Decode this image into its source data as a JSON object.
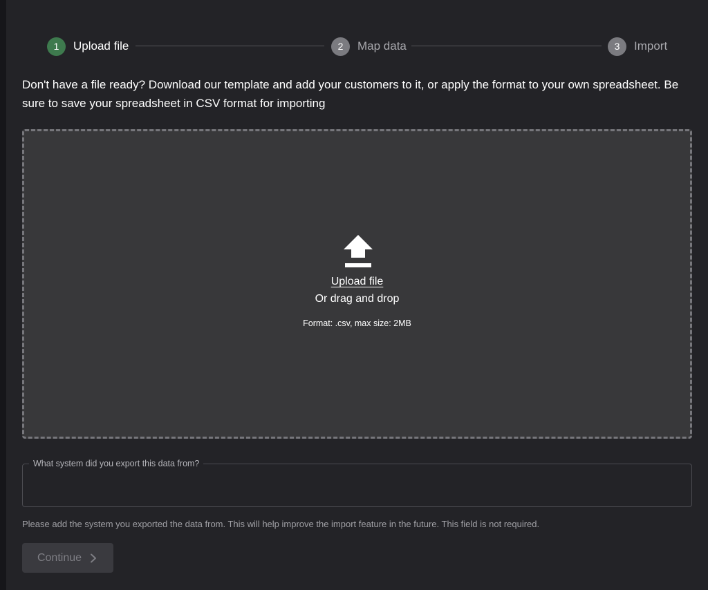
{
  "stepper": {
    "steps": [
      {
        "number": "1",
        "label": "Upload file",
        "state": "active",
        "color": "#3e7a4e"
      },
      {
        "number": "2",
        "label": "Map data",
        "state": "pending"
      },
      {
        "number": "3",
        "label": "Import",
        "state": "pending"
      }
    ]
  },
  "intro": {
    "text": "Don't have a file ready? Download our template and add your customers to it, or apply the format to your own spreadsheet. Be sure to save your spreadsheet in CSV format for importing"
  },
  "dropzone": {
    "icon": "upload-icon",
    "link_label": "Upload file",
    "drag_text": "Or drag and drop",
    "format_text": "Format: .csv, max size: 2MB"
  },
  "system_field": {
    "label": "What system did you export this data from?",
    "value": "",
    "helper": "Please add the system you exported the data from. This will help improve the import feature in the future. This field is not required."
  },
  "actions": {
    "continue_label": "Continue",
    "continue_icon": "chevron-right-icon",
    "continue_disabled": true
  }
}
